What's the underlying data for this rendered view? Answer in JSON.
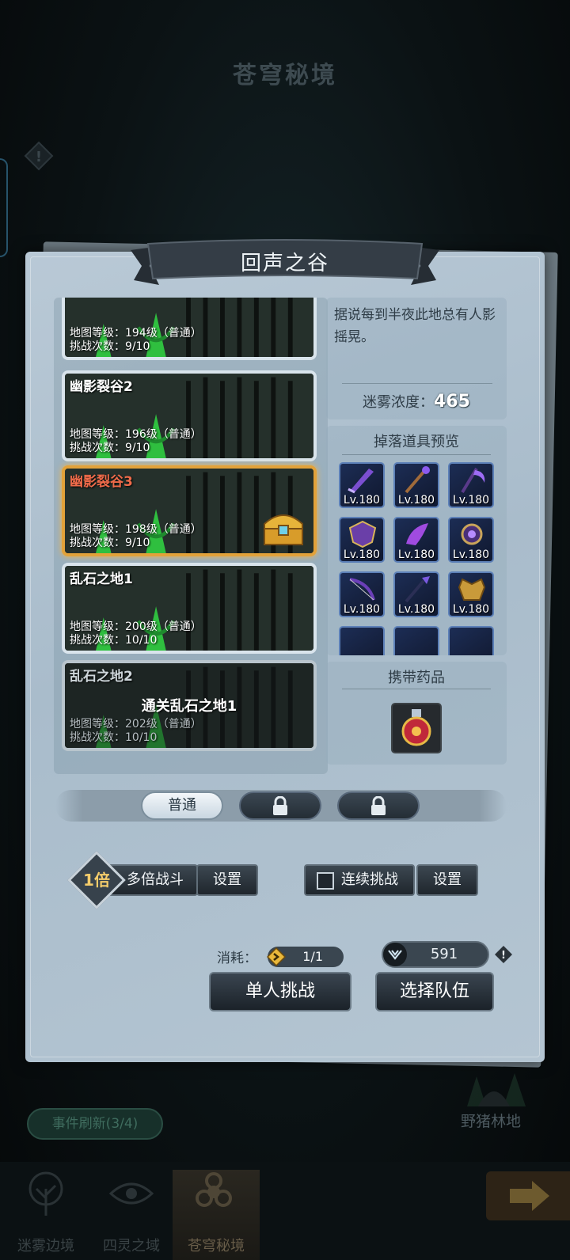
{
  "header": {
    "title": "苍穹秘境"
  },
  "panel": {
    "title": "回声之谷"
  },
  "maps": [
    {
      "name": "",
      "level": "地图等级：194级（普通）",
      "attempts": "挑战次数：9/10",
      "state": "normal"
    },
    {
      "name": "幽影裂谷2",
      "level": "地图等级：196级（普通）",
      "attempts": "挑战次数：9/10",
      "state": "normal"
    },
    {
      "name": "幽影裂谷3",
      "level": "地图等级：198级（普通）",
      "attempts": "挑战次数：9/10",
      "state": "selected"
    },
    {
      "name": "乱石之地1",
      "level": "地图等级：200级（普通）",
      "attempts": "挑战次数：10/10",
      "state": "normal"
    },
    {
      "name": "乱石之地2",
      "level": "地图等级：202级（普通）",
      "attempts": "挑战次数：10/10",
      "state": "locked",
      "unlock_text": "通关乱石之地1"
    }
  ],
  "description": "据说每到半夜此地总有人影摇晃。",
  "fog": {
    "label": "迷雾浓度：",
    "value": "465"
  },
  "drops": {
    "title": "掉落道具预览",
    "items": [
      {
        "icon": "blade-icon",
        "level": "Lv.180"
      },
      {
        "icon": "staff-icon",
        "level": "Lv.180"
      },
      {
        "icon": "scythe-icon",
        "level": "Lv.180"
      },
      {
        "icon": "shield-icon",
        "level": "Lv.180"
      },
      {
        "icon": "horn-icon",
        "level": "Lv.180"
      },
      {
        "icon": "orb-icon",
        "level": "Lv.180"
      },
      {
        "icon": "bow-icon",
        "level": "Lv.180"
      },
      {
        "icon": "spear-icon",
        "level": "Lv.180"
      },
      {
        "icon": "armor-icon",
        "level": "Lv.180"
      }
    ]
  },
  "potions": {
    "title": "携带药品",
    "icon": "potion-icon"
  },
  "difficulty": {
    "tabs": [
      {
        "label": "普通",
        "active": true
      },
      {
        "label": "",
        "locked": true
      },
      {
        "label": "",
        "locked": true
      }
    ]
  },
  "options": {
    "multiplier": "1倍",
    "multi_battle": "多倍战斗",
    "settings": "设置",
    "continuous": "连续挑战",
    "settings2": "设置"
  },
  "cost": {
    "label": "消耗：",
    "value": "1/1"
  },
  "power": {
    "value": "591"
  },
  "actions": {
    "solo": "单人挑战",
    "team": "选择队伍"
  },
  "map_label": "野猪林地",
  "event_refresh": "事件刷新(3/4)",
  "nav": [
    {
      "label": "迷雾边境",
      "active": false
    },
    {
      "label": "四灵之域",
      "active": false
    },
    {
      "label": "苍穹秘境",
      "active": true
    }
  ],
  "colors": {
    "selected_border": "#e2a23a",
    "selected_name": "#ef6b4a",
    "item_border": "#5c80b8"
  }
}
